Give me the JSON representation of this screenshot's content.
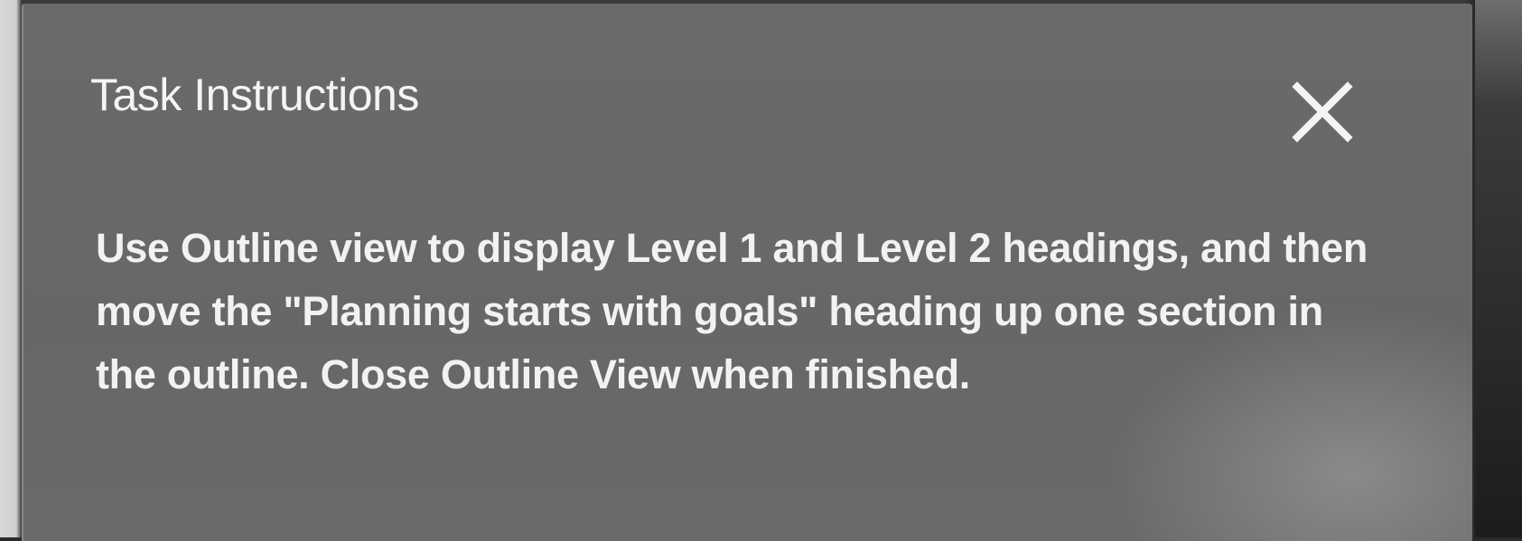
{
  "dialog": {
    "title": "Task Instructions",
    "close_icon": "close-icon",
    "instructions": "Use Outline view to display Level 1 and Level 2 headings, and then move the \"Planning starts with goals\" heading up one section in the outline. Close Outline View when finished."
  },
  "colors": {
    "panel_background": "#6b6b6b",
    "text": "#f2f2f2"
  }
}
